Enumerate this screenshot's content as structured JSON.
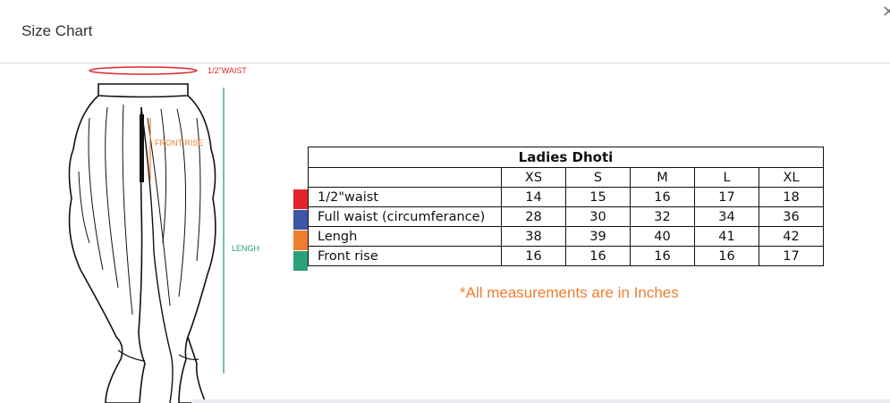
{
  "header": {
    "title": "Size Chart",
    "close_icon": "close-icon"
  },
  "figure": {
    "waist_label": "1/2\"WAIST",
    "front_rise_label": "FRONT RISE",
    "length_label": "LENGH",
    "colors": {
      "waist": "#e0252a",
      "front_rise": "#ee7d2f",
      "length": "#2ba17a"
    }
  },
  "table": {
    "title": "Ladies Dhoti",
    "sizes": [
      "XS",
      "S",
      "M",
      "L",
      "XL"
    ],
    "rows": [
      {
        "label": "1/2\"waist",
        "color": "#e0252a",
        "values": [
          "14",
          "15",
          "16",
          "17",
          "18"
        ]
      },
      {
        "label": "Full waist (circumferance)",
        "color": "#3e56a6",
        "values": [
          "28",
          "30",
          "32",
          "34",
          "36"
        ]
      },
      {
        "label": "Lengh",
        "color": "#ee7d2f",
        "values": [
          "38",
          "39",
          "40",
          "41",
          "42"
        ]
      },
      {
        "label": "Front rise",
        "color": "#2ba17a",
        "values": [
          "16",
          "16",
          "16",
          "16",
          "17"
        ]
      }
    ]
  },
  "note": "*All measurements are in Inches"
}
